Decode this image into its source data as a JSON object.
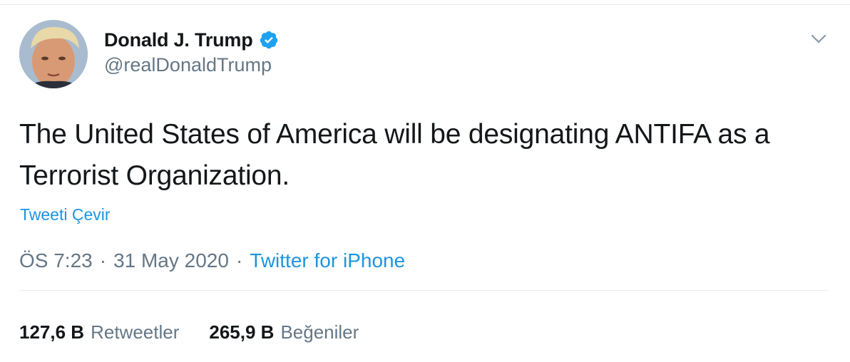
{
  "header": {
    "display_name": "Donald J. Trump",
    "handle": "@realDonaldTrump",
    "verified_icon": "verified-badge-icon",
    "menu_icon": "chevron-down-icon"
  },
  "tweet": {
    "text": "The United States of America will be designating ANTIFA as a Terrorist Organization.",
    "translate_label": "Tweeti Çevir"
  },
  "meta": {
    "time": "ÖS 7:23",
    "separator": "·",
    "date": "31 May 2020",
    "source": "Twitter for iPhone"
  },
  "stats": {
    "retweets_count": "127,6 B",
    "retweets_label": "Retweetler",
    "likes_count": "265,9 B",
    "likes_label": "Beğeniler"
  },
  "colors": {
    "link": "#1b95e0",
    "secondary_text": "#657786",
    "primary_text": "#14171a",
    "verified": "#1da1f2",
    "divider": "#e6ecf0"
  }
}
